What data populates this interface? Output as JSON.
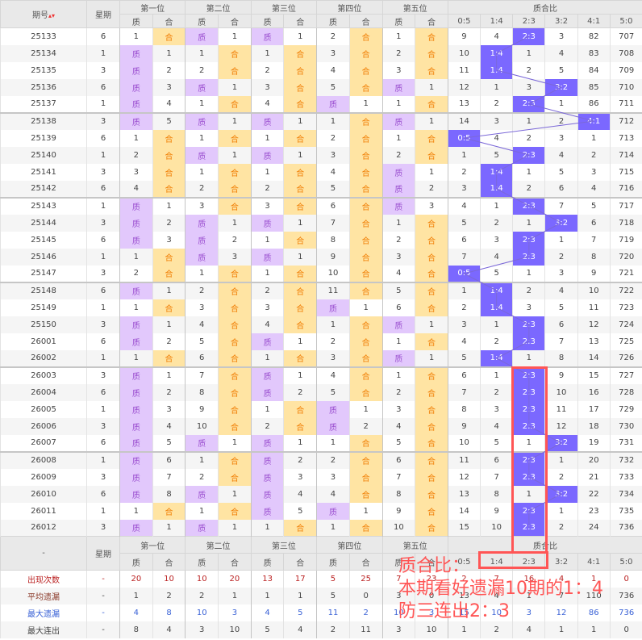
{
  "header": {
    "period": "期号",
    "weekday": "星期",
    "positions": [
      "第一位",
      "第二位",
      "第三位",
      "第四位",
      "第五位"
    ],
    "zhi": "质",
    "he": "合",
    "ratio_title": "质合比",
    "ratios": [
      "0:5",
      "1:4",
      "2:3",
      "3:2",
      "4:1",
      "5:0"
    ],
    "sort_icon": "▴▾"
  },
  "rows": [
    [
      "25133",
      "6",
      "1",
      "合",
      "质",
      "1",
      "质",
      "1",
      "2",
      "合",
      "1",
      "合",
      "9",
      "4",
      "2:3",
      "3",
      "82",
      "707"
    ],
    [
      "25134",
      "1",
      "质",
      "1",
      "1",
      "合",
      "1",
      "合",
      "3",
      "合",
      "2",
      "合",
      "10",
      "1:4",
      "1",
      "4",
      "83",
      "708"
    ],
    [
      "25135",
      "3",
      "质",
      "2",
      "2",
      "合",
      "2",
      "合",
      "4",
      "合",
      "3",
      "合",
      "11",
      "1:4",
      "2",
      "5",
      "84",
      "709"
    ],
    [
      "25136",
      "6",
      "质",
      "3",
      "质",
      "1",
      "3",
      "合",
      "5",
      "合",
      "质",
      "1",
      "12",
      "1",
      "3",
      "3:2",
      "85",
      "710"
    ],
    [
      "25137",
      "1",
      "质",
      "4",
      "1",
      "合",
      "4",
      "合",
      "质",
      "1",
      "1",
      "合",
      "13",
      "2",
      "2:3",
      "1",
      "86",
      "711"
    ],
    [
      "25138",
      "3",
      "质",
      "5",
      "质",
      "1",
      "质",
      "1",
      "1",
      "合",
      "质",
      "1",
      "14",
      "3",
      "1",
      "2",
      "4:1",
      "712"
    ],
    [
      "25139",
      "6",
      "1",
      "合",
      "1",
      "合",
      "1",
      "合",
      "2",
      "合",
      "1",
      "合",
      "0:5",
      "4",
      "2",
      "3",
      "1",
      "713"
    ],
    [
      "25140",
      "1",
      "2",
      "合",
      "质",
      "1",
      "质",
      "1",
      "3",
      "合",
      "2",
      "合",
      "1",
      "5",
      "2:3",
      "4",
      "2",
      "714"
    ],
    [
      "25141",
      "3",
      "3",
      "合",
      "1",
      "合",
      "1",
      "合",
      "4",
      "合",
      "质",
      "1",
      "2",
      "1:4",
      "1",
      "5",
      "3",
      "715"
    ],
    [
      "25142",
      "6",
      "4",
      "合",
      "2",
      "合",
      "2",
      "合",
      "5",
      "合",
      "质",
      "2",
      "3",
      "1:4",
      "2",
      "6",
      "4",
      "716"
    ],
    [
      "25143",
      "1",
      "质",
      "1",
      "3",
      "合",
      "3",
      "合",
      "6",
      "合",
      "质",
      "3",
      "4",
      "1",
      "2:3",
      "7",
      "5",
      "717"
    ],
    [
      "25144",
      "3",
      "质",
      "2",
      "质",
      "1",
      "质",
      "1",
      "7",
      "合",
      "1",
      "合",
      "5",
      "2",
      "1",
      "3:2",
      "6",
      "718"
    ],
    [
      "25145",
      "6",
      "质",
      "3",
      "质",
      "2",
      "1",
      "合",
      "8",
      "合",
      "2",
      "合",
      "6",
      "3",
      "2:3",
      "1",
      "7",
      "719"
    ],
    [
      "25146",
      "1",
      "1",
      "合",
      "质",
      "3",
      "质",
      "1",
      "9",
      "合",
      "3",
      "合",
      "7",
      "4",
      "2:3",
      "2",
      "8",
      "720"
    ],
    [
      "25147",
      "3",
      "2",
      "合",
      "1",
      "合",
      "1",
      "合",
      "10",
      "合",
      "4",
      "合",
      "0:5",
      "5",
      "1",
      "3",
      "9",
      "721"
    ],
    [
      "25148",
      "6",
      "质",
      "1",
      "2",
      "合",
      "2",
      "合",
      "11",
      "合",
      "5",
      "合",
      "1",
      "1:4",
      "2",
      "4",
      "10",
      "722"
    ],
    [
      "25149",
      "1",
      "1",
      "合",
      "3",
      "合",
      "3",
      "合",
      "质",
      "1",
      "6",
      "合",
      "2",
      "1:4",
      "3",
      "5",
      "11",
      "723"
    ],
    [
      "25150",
      "3",
      "质",
      "1",
      "4",
      "合",
      "4",
      "合",
      "1",
      "合",
      "质",
      "1",
      "3",
      "1",
      "2:3",
      "6",
      "12",
      "724"
    ],
    [
      "26001",
      "6",
      "质",
      "2",
      "5",
      "合",
      "质",
      "1",
      "2",
      "合",
      "1",
      "合",
      "4",
      "2",
      "2:3",
      "7",
      "13",
      "725"
    ],
    [
      "26002",
      "1",
      "1",
      "合",
      "6",
      "合",
      "1",
      "合",
      "3",
      "合",
      "质",
      "1",
      "5",
      "1:4",
      "1",
      "8",
      "14",
      "726"
    ],
    [
      "26003",
      "3",
      "质",
      "1",
      "7",
      "合",
      "质",
      "1",
      "4",
      "合",
      "1",
      "合",
      "6",
      "1",
      "2:3",
      "9",
      "15",
      "727"
    ],
    [
      "26004",
      "6",
      "质",
      "2",
      "8",
      "合",
      "质",
      "2",
      "5",
      "合",
      "2",
      "合",
      "7",
      "2",
      "2:3",
      "10",
      "16",
      "728"
    ],
    [
      "26005",
      "1",
      "质",
      "3",
      "9",
      "合",
      "1",
      "合",
      "质",
      "1",
      "3",
      "合",
      "8",
      "3",
      "2:3",
      "11",
      "17",
      "729"
    ],
    [
      "26006",
      "3",
      "质",
      "4",
      "10",
      "合",
      "2",
      "合",
      "质",
      "2",
      "4",
      "合",
      "9",
      "4",
      "2:3",
      "12",
      "18",
      "730"
    ],
    [
      "26007",
      "6",
      "质",
      "5",
      "质",
      "1",
      "质",
      "1",
      "1",
      "合",
      "5",
      "合",
      "10",
      "5",
      "1",
      "3:2",
      "19",
      "731"
    ],
    [
      "26008",
      "1",
      "质",
      "6",
      "1",
      "合",
      "质",
      "2",
      "2",
      "合",
      "6",
      "合",
      "11",
      "6",
      "2:3",
      "1",
      "20",
      "732"
    ],
    [
      "26009",
      "3",
      "质",
      "7",
      "2",
      "合",
      "质",
      "3",
      "3",
      "合",
      "7",
      "合",
      "12",
      "7",
      "2:3",
      "2",
      "21",
      "733"
    ],
    [
      "26010",
      "6",
      "质",
      "8",
      "质",
      "1",
      "质",
      "4",
      "4",
      "合",
      "8",
      "合",
      "13",
      "8",
      "1",
      "3:2",
      "22",
      "734"
    ],
    [
      "26011",
      "1",
      "1",
      "合",
      "1",
      "合",
      "质",
      "5",
      "质",
      "1",
      "9",
      "合",
      "14",
      "9",
      "2:3",
      "1",
      "23",
      "735"
    ],
    [
      "26012",
      "3",
      "质",
      "1",
      "质",
      "1",
      "1",
      "合",
      "1",
      "合",
      "10",
      "合",
      "15",
      "10",
      "2:3",
      "2",
      "24",
      "736"
    ]
  ],
  "footer": {
    "dash": "-",
    "stats": [
      {
        "label": "出现次数",
        "cls": "c-red",
        "values": [
          "-",
          "20",
          "10",
          "10",
          "20",
          "13",
          "17",
          "5",
          "25",
          "7",
          "23",
          "2",
          "7",
          "16",
          "4",
          "1",
          "0"
        ]
      },
      {
        "label": "平均遗漏",
        "cls": "c-avg",
        "values": [
          "-",
          "1",
          "2",
          "2",
          "1",
          "1",
          "1",
          "5",
          "0",
          "3",
          "0",
          "13",
          "4",
          "1",
          "7",
          "110",
          "736"
        ]
      },
      {
        "label": "最大遗漏",
        "cls": "c-blue",
        "values": [
          "-",
          "4",
          "8",
          "10",
          "3",
          "4",
          "5",
          "11",
          "2",
          "10",
          "3",
          "15",
          "10",
          "3",
          "12",
          "86",
          "736"
        ]
      },
      {
        "label": "最大连出",
        "cls": "",
        "values": [
          "-",
          "8",
          "4",
          "3",
          "10",
          "5",
          "4",
          "2",
          "11",
          "3",
          "10",
          "1",
          "2",
          "4",
          "1",
          "1",
          "0"
        ]
      }
    ]
  },
  "annotation": {
    "lines": [
      "质合比：",
      "本期看好遗漏10期的1：4",
      "防三连出2：3"
    ]
  },
  "colors": {
    "zhi_bg": "#e2c8fc",
    "he_bg": "#ffe4a3",
    "ratio_bg": "#7b68ff",
    "annotation": "#ff5555"
  }
}
